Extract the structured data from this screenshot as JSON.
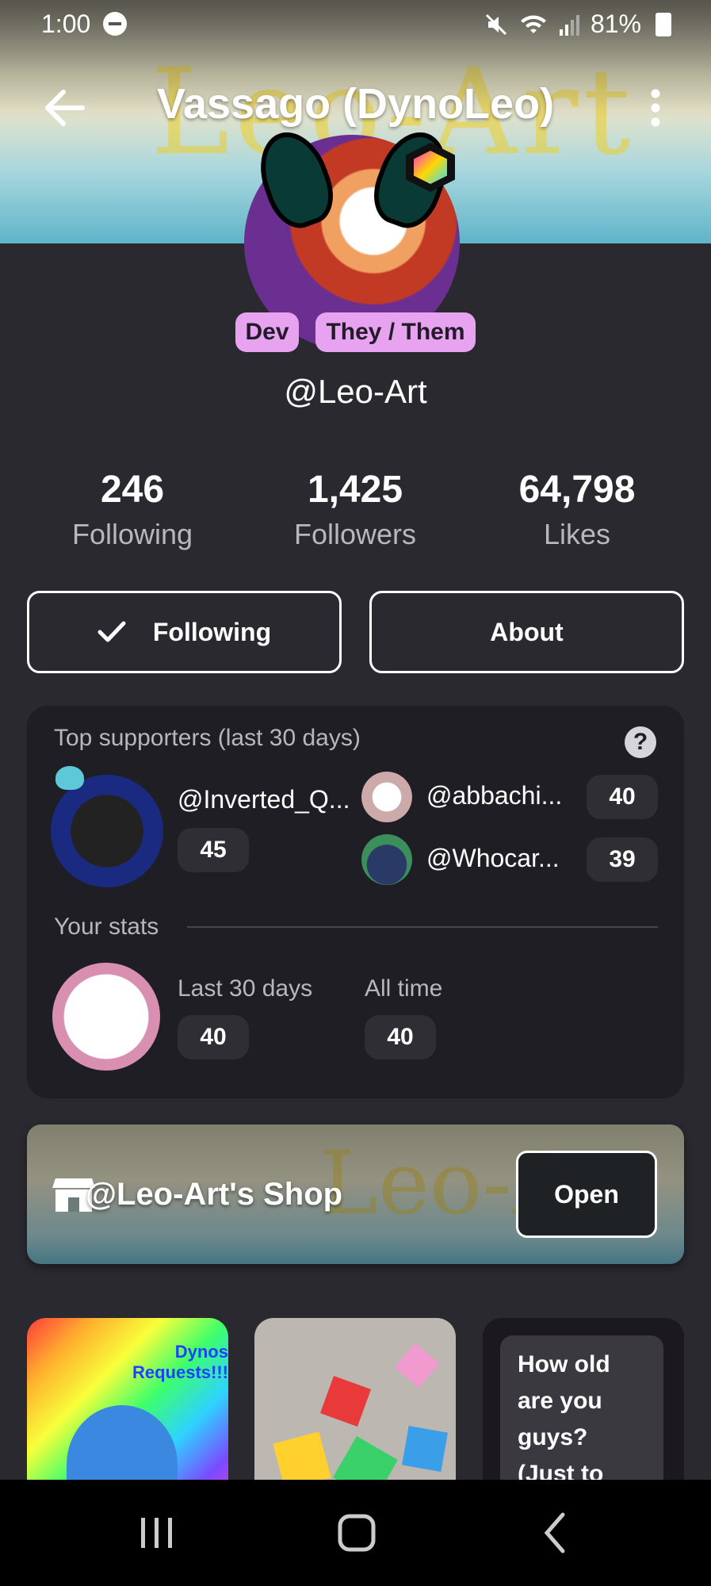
{
  "status_bar": {
    "time": "1:00",
    "battery": "81%"
  },
  "header": {
    "title": "Vassago (DynoLeo)",
    "banner_text": "Leo-Art"
  },
  "profile": {
    "pronoun_badges": [
      "Dev",
      "They / Them"
    ],
    "handle": "@Leo-Art"
  },
  "stats": [
    {
      "value": "246",
      "label": "Following"
    },
    {
      "value": "1,425",
      "label": "Followers"
    },
    {
      "value": "64,798",
      "label": "Likes"
    }
  ],
  "buttons": {
    "following": "Following",
    "about": "About"
  },
  "supporters": {
    "title": "Top supporters (last 30 days)",
    "top": {
      "name": "@Inverted_Q...",
      "count": "45"
    },
    "others": [
      {
        "name": "@abbachi...",
        "count": "40"
      },
      {
        "name": "@Whocar...",
        "count": "39"
      }
    ]
  },
  "your_stats": {
    "title": "Your stats",
    "last30_label": "Last 30 days",
    "last30_value": "40",
    "alltime_label": "All time",
    "alltime_value": "40"
  },
  "shop": {
    "title": "@Leo-Art's Shop",
    "open": "Open",
    "banner_text": "Leo-Art"
  },
  "posts": {
    "p1_caption": "Dynos Requests!!!",
    "p3_text": "How old are you guys? (Just to"
  },
  "colors": {
    "background": "#2a2930",
    "card": "#1f1e25",
    "pill": "#e7a3f0",
    "accent_green": "#7bd64a"
  },
  "icons": [
    "back-arrow-icon",
    "more-vert-icon",
    "check-icon",
    "help-icon",
    "store-icon",
    "recents-icon",
    "home-icon",
    "back-nav-icon"
  ]
}
